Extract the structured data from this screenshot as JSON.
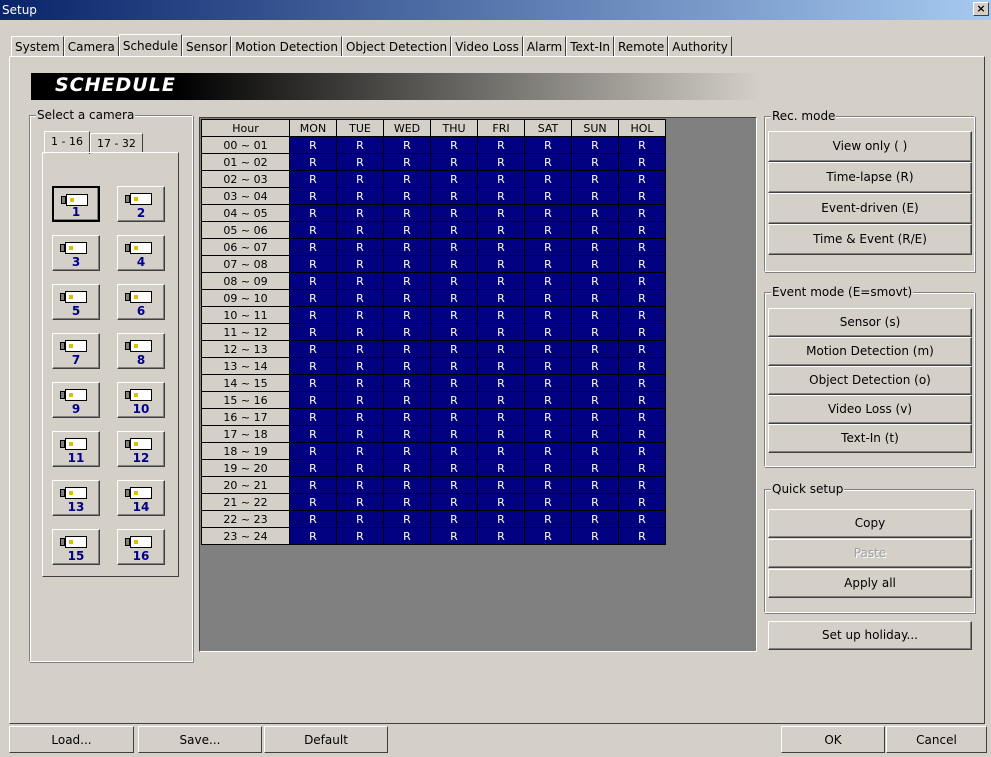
{
  "window": {
    "title": "Setup",
    "close_label": "×"
  },
  "tabs": [
    "System",
    "Camera",
    "Schedule",
    "Sensor",
    "Motion Detection",
    "Object Detection",
    "Video Loss",
    "Alarm",
    "Text-In",
    "Remote",
    "Authority"
  ],
  "active_tab": "Schedule",
  "banner": "SCHEDULE",
  "camera_group": {
    "label": "Select a camera",
    "tabs": [
      "1 - 16",
      "17 - 32"
    ],
    "cameras": [
      "1",
      "2",
      "3",
      "4",
      "5",
      "6",
      "7",
      "8",
      "9",
      "10",
      "11",
      "12",
      "13",
      "14",
      "15",
      "16"
    ],
    "selected": "1"
  },
  "schedule": {
    "hour_header": "Hour",
    "days": [
      "MON",
      "TUE",
      "WED",
      "THU",
      "FRI",
      "SAT",
      "SUN",
      "HOL"
    ],
    "hours": [
      "00 ~ 01",
      "01 ~ 02",
      "02 ~ 03",
      "03 ~ 04",
      "04 ~ 05",
      "05 ~ 06",
      "06 ~ 07",
      "07 ~ 08",
      "08 ~ 09",
      "09 ~ 10",
      "10 ~ 11",
      "11 ~ 12",
      "12 ~ 13",
      "13 ~ 14",
      "14 ~ 15",
      "15 ~ 16",
      "16 ~ 17",
      "17 ~ 18",
      "18 ~ 19",
      "19 ~ 20",
      "20 ~ 21",
      "21 ~ 22",
      "22 ~ 23",
      "23 ~ 24"
    ],
    "cell_value": "R"
  },
  "rec_mode": {
    "label": "Rec. mode",
    "buttons": [
      "View only ( )",
      "Time-lapse (R)",
      "Event-driven (E)",
      "Time & Event (R/E)"
    ]
  },
  "event_mode": {
    "label": "Event mode (E=smovt)",
    "buttons": [
      "Sensor (s)",
      "Motion Detection (m)",
      "Object Detection (o)",
      "Video Loss (v)",
      "Text-In (t)"
    ]
  },
  "quick_setup": {
    "label": "Quick setup",
    "copy": "Copy",
    "paste": "Paste",
    "apply_all": "Apply all"
  },
  "holiday_button": "Set up holiday...",
  "footer": {
    "load": "Load...",
    "save": "Save...",
    "default": "Default",
    "ok": "OK",
    "cancel": "Cancel"
  },
  "colors": {
    "cell_bg": "#000080",
    "cell_text": "#ffffff",
    "face": "#d4d0c8",
    "title_start": "#0a246a",
    "title_end": "#a6caf0"
  }
}
